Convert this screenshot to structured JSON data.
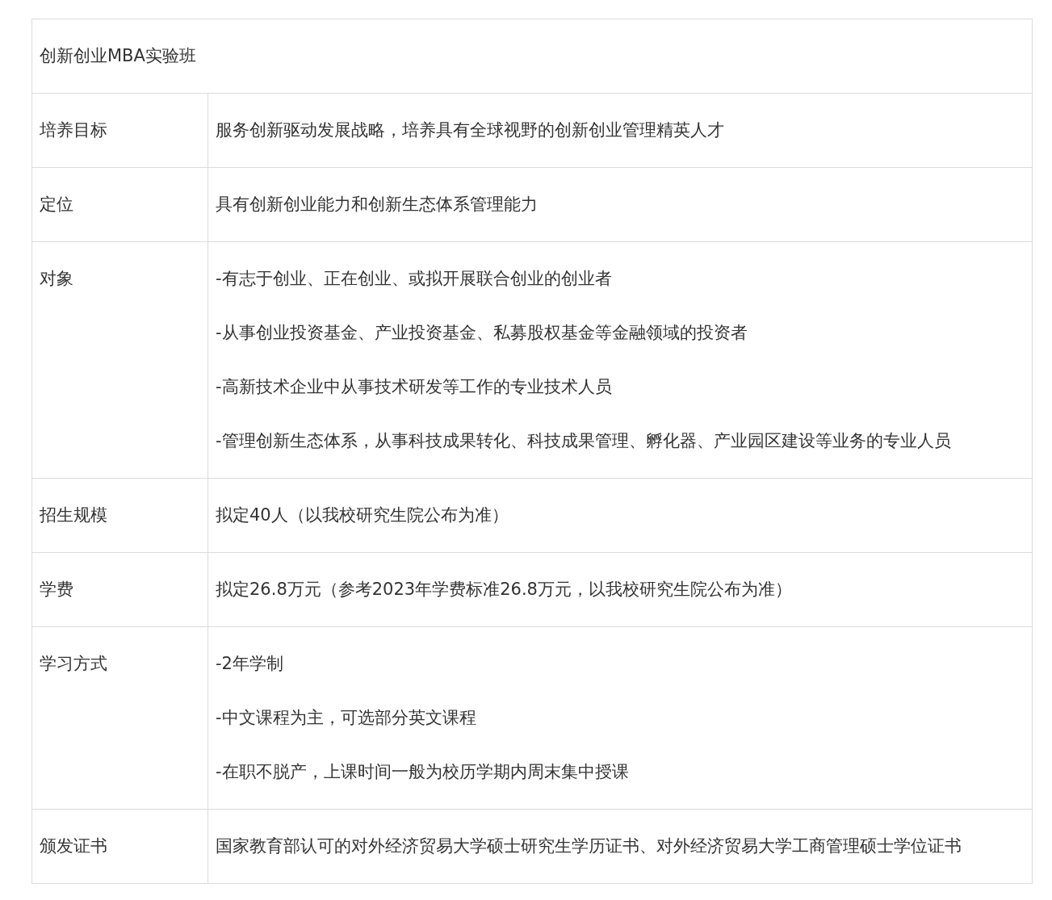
{
  "table": {
    "title": "创新创业MBA实验班",
    "rows": [
      {
        "label": "培养目标",
        "lines": [
          "服务创新驱动发展战略，培养具有全球视野的创新创业管理精英人才"
        ]
      },
      {
        "label": "定位",
        "lines": [
          "具有创新创业能力和创新生态体系管理能力"
        ]
      },
      {
        "label": "对象",
        "lines": [
          "-有志于创业、正在创业、或拟开展联合创业的创业者",
          "-从事创业投资基金、产业投资基金、私募股权基金等金融领域的投资者",
          "-高新技术企业中从事技术研发等工作的专业技术人员",
          "-管理创新生态体系，从事科技成果转化、科技成果管理、孵化器、产业园区建设等业务的专业人员"
        ]
      },
      {
        "label": "招生规模",
        "lines": [
          "拟定40人（以我校研究生院公布为准）"
        ]
      },
      {
        "label": "学费",
        "lines": [
          "拟定26.8万元（参考2023年学费标准26.8万元，以我校研究生院公布为准）"
        ]
      },
      {
        "label": "学习方式",
        "lines": [
          "-2年学制",
          "-中文课程为主，可选部分英文课程",
          "-在职不脱产，上课时间一般为校历学期内周末集中授课"
        ]
      },
      {
        "label": "颁发证书",
        "lines": [
          "国家教育部认可的对外经济贸易大学硕士研究生学历证书、对外经济贸易大学工商管理硕士学位证书"
        ]
      }
    ]
  }
}
